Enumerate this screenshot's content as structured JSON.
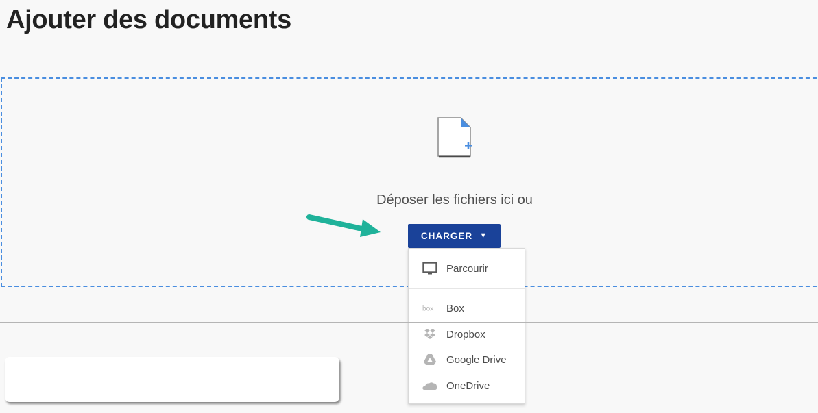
{
  "page": {
    "title": "Ajouter des documents"
  },
  "dropzone": {
    "icon": "file-add-icon",
    "text": "Déposer les fichiers ici ou",
    "border_color": "#4a8ee0"
  },
  "upload_button": {
    "label": "CHARGER",
    "caret": "▼",
    "color": "#1a4299"
  },
  "menu": {
    "items": [
      {
        "label": "Parcourir",
        "icon": "monitor-icon"
      },
      {
        "label": "Box",
        "icon": "box-icon"
      },
      {
        "label": "Dropbox",
        "icon": "dropbox-icon"
      },
      {
        "label": "Google Drive",
        "icon": "google-drive-icon"
      },
      {
        "label": "OneDrive",
        "icon": "onedrive-icon"
      }
    ]
  },
  "annotation": {
    "arrow_color": "#1fb29a"
  }
}
